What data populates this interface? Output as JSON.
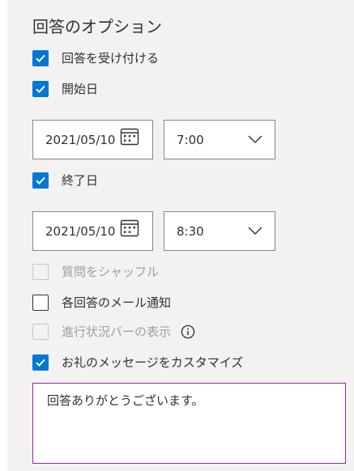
{
  "options": {
    "title": "回答のオプション",
    "accept_responses": {
      "label": "回答を受け付ける",
      "checked": true
    },
    "start_date": {
      "label": "開始日",
      "checked": true,
      "date": "2021/05/10",
      "time": "7:00"
    },
    "end_date": {
      "label": "終了日",
      "checked": true,
      "date": "2021/05/10",
      "time": "8:30"
    },
    "shuffle_questions": {
      "label": "質問をシャッフル",
      "checked": false,
      "disabled": true
    },
    "email_notification": {
      "label": "各回答のメール通知",
      "checked": false
    },
    "progress_bar": {
      "label": "進行状況バーの表示",
      "checked": false,
      "disabled": true,
      "icon": "info-icon"
    },
    "custom_thanks": {
      "label": "お礼のメッセージをカスタマイズ",
      "checked": true,
      "message": "回答ありがとうございます。"
    }
  },
  "colors": {
    "accent": "#0078d4",
    "panel_bg": "#f3f2f1",
    "text": "#323130",
    "disabled_text": "#a19f9d",
    "textarea_border": "#8c2c9c"
  }
}
